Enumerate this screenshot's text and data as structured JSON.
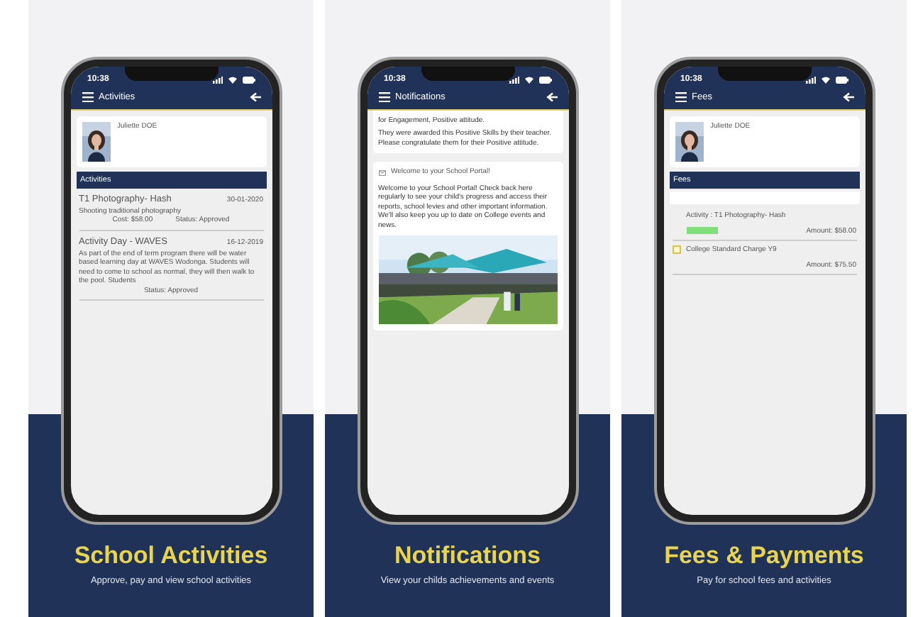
{
  "panels": [
    {
      "kind": "activities",
      "phone": {
        "time": "10:38",
        "screen_title": "Activities",
        "profile": {
          "name": "Juliette DOE"
        },
        "section": "Activities",
        "activities": [
          {
            "title": "T1 Photography- Hash",
            "date": "30-01-2020",
            "description": "Shooting traditional photography",
            "cost": "Cost: $58.00",
            "status": "Status: Approved"
          },
          {
            "title": "Activity Day - WAVES",
            "date": "16-12-2019",
            "description": "As part of the end of term program there will be water based learning day at WAVES Wodonga. Students will need to come to school as normal, they will then walk to the pool. Students",
            "status": "Status: Approved"
          }
        ]
      },
      "caption": {
        "title": "School Activities",
        "subtitle": "Approve, pay and view school activities"
      }
    },
    {
      "kind": "notifications",
      "phone": {
        "time": "10:38",
        "screen_title": "Notifications",
        "top_paragraphs": [
          "for Engagement, Positive attitude.",
          "They were awarded this Positive Skills by their teacher. Please congratulate them for their Positive attitude."
        ],
        "card": {
          "title": "Welcome to your School Portal!",
          "body": "Welcome to your School Portal! Check back here regularly to see your child's progress and access their reports, school levies and other important information. We'll also keep you up to date on College events and news."
        }
      },
      "caption": {
        "title": "Notifications",
        "subtitle": "View your childs achievements and events"
      }
    },
    {
      "kind": "fees",
      "phone": {
        "time": "10:38",
        "screen_title": "Fees",
        "profile": {
          "name": "Juliette DOE"
        },
        "section": "Fees",
        "fees": [
          {
            "kind": "tagged",
            "title": "Activity : T1 Photography- Hash",
            "amount": "Amount: $58.00"
          },
          {
            "kind": "checkbox",
            "checked": false,
            "title": "College Standard Charge Y9",
            "amount": "Amount: $75.50"
          }
        ]
      },
      "caption": {
        "title": "Fees & Payments",
        "subtitle": "Pay for school fees and activities"
      }
    }
  ]
}
